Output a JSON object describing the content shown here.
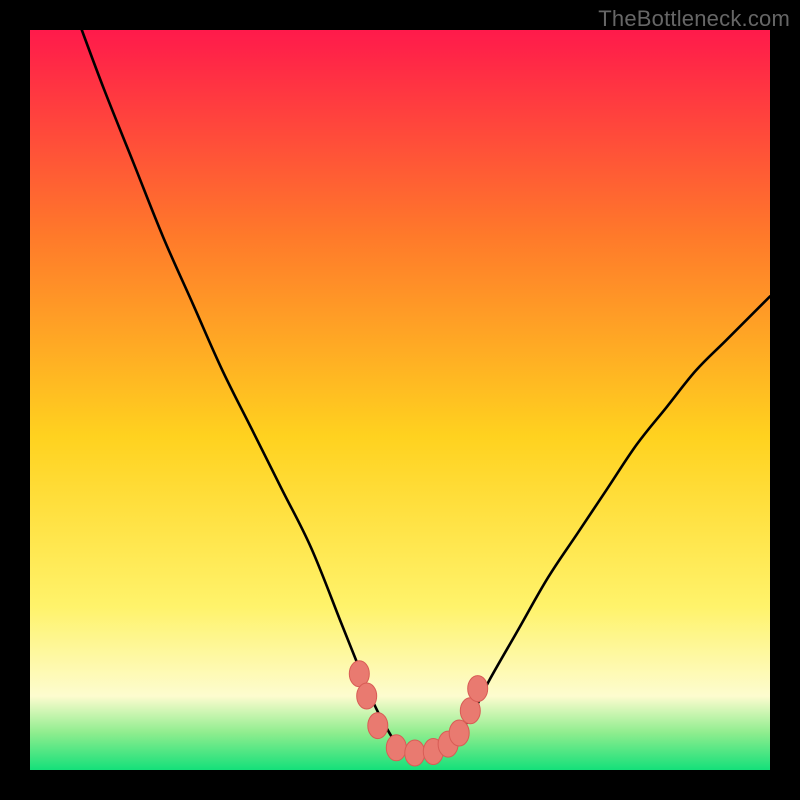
{
  "watermark": "TheBottleneck.com",
  "colors": {
    "background": "#000000",
    "curve": "#000000",
    "marker_fill": "#e97a70",
    "marker_stroke": "#d85c55",
    "gradient": {
      "top": "#ff1a4b",
      "upper_mid": "#ff7a2a",
      "mid": "#ffd21f",
      "lower_mid": "#fff36b",
      "pale": "#fdfccf",
      "green_top": "#8eed8e",
      "green_bottom": "#14e07a"
    }
  },
  "chart_data": {
    "type": "line",
    "title": "",
    "xlabel": "",
    "ylabel": "",
    "xlim": [
      0,
      100
    ],
    "ylim": [
      0,
      100
    ],
    "series": [
      {
        "name": "curve",
        "x": [
          7,
          10,
          14,
          18,
          22,
          26,
          30,
          34,
          38,
          42,
          44,
          46,
          48,
          50,
          52,
          54,
          56,
          58,
          60,
          62,
          66,
          70,
          74,
          78,
          82,
          86,
          90,
          94,
          98,
          100
        ],
        "y": [
          100,
          92,
          82,
          72,
          63,
          54,
          46,
          38,
          30,
          20,
          15,
          10,
          6,
          3,
          2,
          2,
          3,
          5,
          8,
          12,
          19,
          26,
          32,
          38,
          44,
          49,
          54,
          58,
          62,
          64
        ]
      }
    ],
    "markers": {
      "name": "highlight-points",
      "x": [
        44.5,
        45.5,
        47,
        49.5,
        52,
        54.5,
        56.5,
        58,
        59.5,
        60.5
      ],
      "y": [
        13,
        10,
        6,
        3,
        2.3,
        2.5,
        3.5,
        5,
        8,
        11
      ]
    }
  }
}
